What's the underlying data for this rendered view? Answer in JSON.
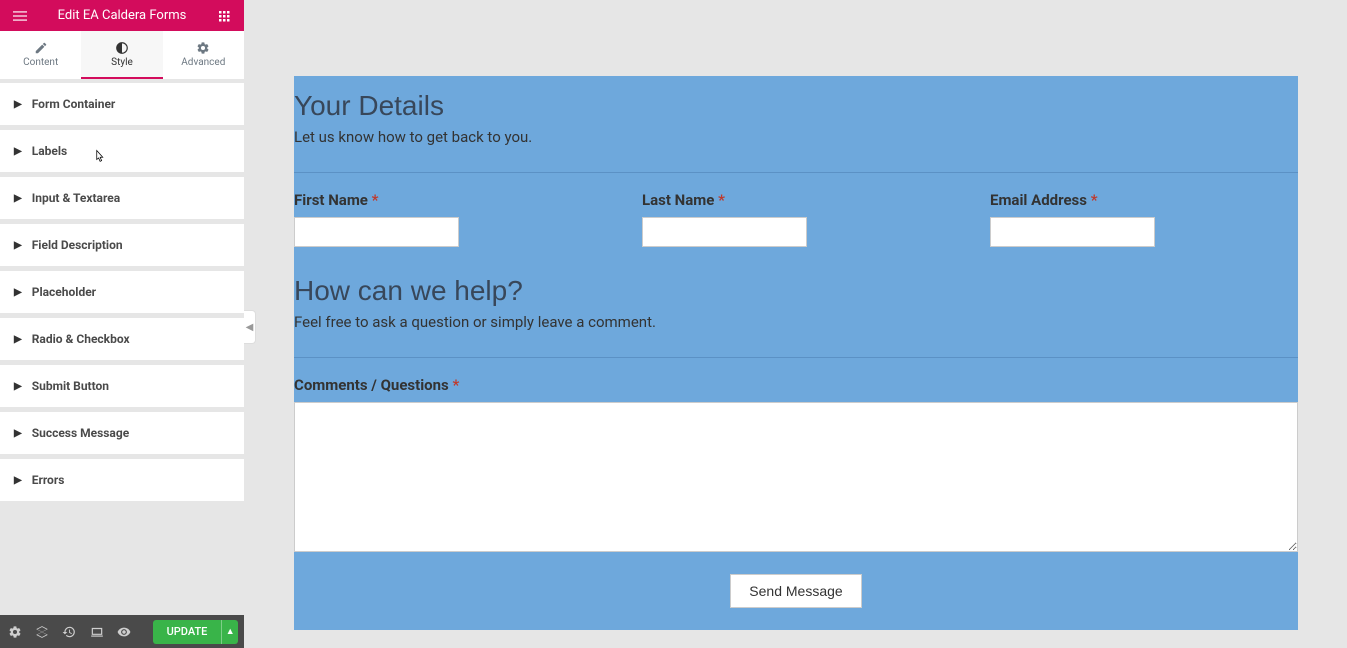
{
  "sidebar": {
    "title": "Edit EA Caldera Forms",
    "tabs": {
      "content": "Content",
      "style": "Style",
      "advanced": "Advanced"
    },
    "sections": [
      "Form Container",
      "Labels",
      "Input & Textarea",
      "Field Description",
      "Placeholder",
      "Radio & Checkbox",
      "Submit Button",
      "Success Message",
      "Errors"
    ]
  },
  "footer": {
    "update_label": "UPDATE"
  },
  "form": {
    "section1_title": "Your Details",
    "section1_desc": "Let us know how to get back to you.",
    "first_name_label": "First Name",
    "last_name_label": "Last Name",
    "email_label": "Email Address",
    "section2_title": "How can we help?",
    "section2_desc": "Feel free to ask a question or simply leave a comment.",
    "comments_label": "Comments / Questions",
    "submit_label": "Send Message",
    "required_mark": "*"
  }
}
